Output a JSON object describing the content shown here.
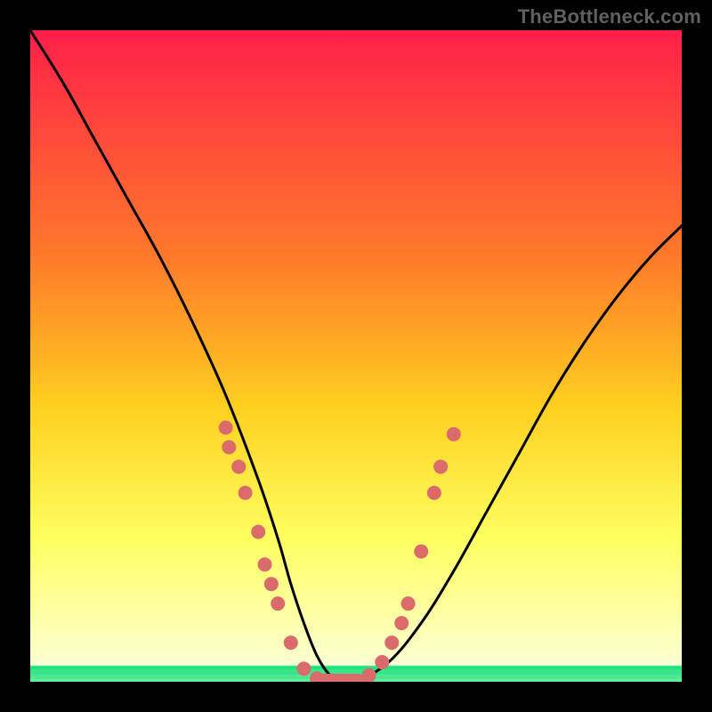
{
  "watermark": "TheBottleneck.com",
  "colors": {
    "frame": "#000000",
    "curve_stroke": "#000000",
    "dot_fill": "#db6b6b",
    "green_band": "#15e07a",
    "gradient_top": "#ff1f49",
    "gradient_mid1": "#ff7a2a",
    "gradient_mid2": "#ffd020",
    "gradient_mid3": "#ffff60",
    "gradient_bottom": "#fbffe0"
  },
  "chart_data": {
    "type": "line",
    "title": "",
    "xlabel": "",
    "ylabel": "",
    "xlim": [
      0,
      100
    ],
    "ylim": [
      0,
      100
    ],
    "series": [
      {
        "name": "bottleneck-curve",
        "x": [
          0,
          5,
          10,
          15,
          20,
          25,
          30,
          35,
          38,
          40,
          42,
          44,
          46,
          48,
          50,
          55,
          60,
          65,
          70,
          75,
          80,
          85,
          90,
          95,
          100
        ],
        "values": [
          100,
          92,
          83,
          74,
          65,
          55,
          44,
          31,
          22,
          15,
          9,
          4,
          1,
          0,
          0,
          3,
          9,
          17,
          26,
          35,
          44,
          52,
          59,
          65,
          70
        ]
      }
    ],
    "scatter_points": [
      {
        "x": 30.0,
        "y": 39.0
      },
      {
        "x": 30.5,
        "y": 36.0
      },
      {
        "x": 32.0,
        "y": 33.0
      },
      {
        "x": 33.0,
        "y": 29.0
      },
      {
        "x": 35.0,
        "y": 23.0
      },
      {
        "x": 36.0,
        "y": 18.0
      },
      {
        "x": 37.0,
        "y": 15.0
      },
      {
        "x": 38.0,
        "y": 12.0
      },
      {
        "x": 40.0,
        "y": 6.0
      },
      {
        "x": 42.0,
        "y": 2.0
      },
      {
        "x": 44.0,
        "y": 0.5
      },
      {
        "x": 46.0,
        "y": 0.0
      },
      {
        "x": 48.0,
        "y": 0.0
      },
      {
        "x": 50.0,
        "y": 0.0
      },
      {
        "x": 52.0,
        "y": 1.0
      },
      {
        "x": 54.0,
        "y": 3.0
      },
      {
        "x": 55.5,
        "y": 6.0
      },
      {
        "x": 57.0,
        "y": 9.0
      },
      {
        "x": 58.0,
        "y": 12.0
      },
      {
        "x": 60.0,
        "y": 20.0
      },
      {
        "x": 62.0,
        "y": 29.0
      },
      {
        "x": 63.0,
        "y": 33.0
      },
      {
        "x": 65.0,
        "y": 38.0
      }
    ],
    "green_band_y": [
      0,
      2.5
    ]
  }
}
